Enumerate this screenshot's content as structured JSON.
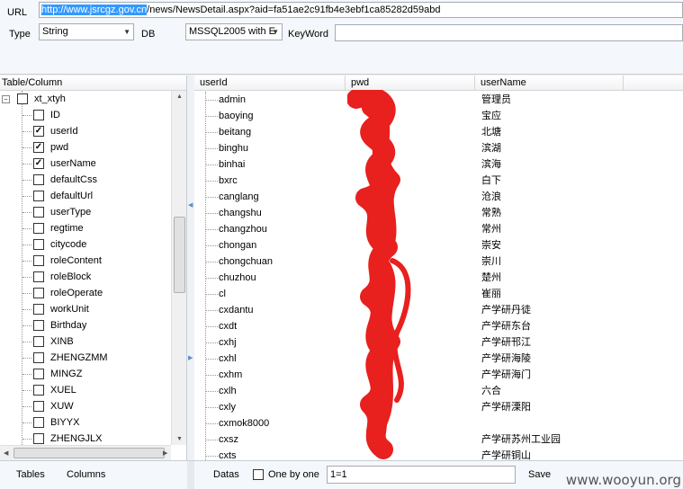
{
  "top": {
    "url_label": "URL",
    "url_selected": "http://www.jsrcgz.gov.cn",
    "url_rest": "/news/NewsDetail.aspx?aid=fa51ae2c91fb4e3ebf1ca85282d59abd",
    "type_label": "Type",
    "type_value": "String",
    "db_label": "DB",
    "db_value": "MSSQL2005 with E",
    "keyword_label": "KeyWord",
    "keyword_value": ""
  },
  "tree": {
    "header": "Table/Column",
    "table": {
      "name": "xt_xtyh",
      "expander": "−"
    },
    "columns": [
      {
        "name": "ID",
        "checked": false
      },
      {
        "name": "userId",
        "checked": true
      },
      {
        "name": "pwd",
        "checked": true
      },
      {
        "name": "userName",
        "checked": true
      },
      {
        "name": "defaultCss",
        "checked": false
      },
      {
        "name": "defaultUrl",
        "checked": false
      },
      {
        "name": "userType",
        "checked": false
      },
      {
        "name": "regtime",
        "checked": false
      },
      {
        "name": "citycode",
        "checked": false
      },
      {
        "name": "roleContent",
        "checked": false
      },
      {
        "name": "roleBlock",
        "checked": false
      },
      {
        "name": "roleOperate",
        "checked": false
      },
      {
        "name": "workUnit",
        "checked": false
      },
      {
        "name": "Birthday",
        "checked": false
      },
      {
        "name": "XINB",
        "checked": false
      },
      {
        "name": "ZHENGZMM",
        "checked": false
      },
      {
        "name": "MINGZ",
        "checked": false
      },
      {
        "name": "XUEL",
        "checked": false
      },
      {
        "name": "XUW",
        "checked": false
      },
      {
        "name": "BIYYX",
        "checked": false
      },
      {
        "name": "ZHENGJLX",
        "checked": false
      }
    ]
  },
  "grid": {
    "headers": [
      "userId",
      "pwd",
      "userName"
    ],
    "rows": [
      {
        "userId": "admin",
        "userName": "管理员"
      },
      {
        "userId": "baoying",
        "userName": "宝应"
      },
      {
        "userId": "beitang",
        "userName": "北塘"
      },
      {
        "userId": "binghu",
        "userName": "滨湖"
      },
      {
        "userId": "binhai",
        "userName": "滨海"
      },
      {
        "userId": "bxrc",
        "userName": "白下"
      },
      {
        "userId": "canglang",
        "userName": "沧浪"
      },
      {
        "userId": "changshu",
        "userName": "常熟"
      },
      {
        "userId": "changzhou",
        "userName": "常州"
      },
      {
        "userId": "chongan",
        "userName": "崇安"
      },
      {
        "userId": "chongchuan",
        "userName": "崇川"
      },
      {
        "userId": "chuzhou",
        "userName": "楚州"
      },
      {
        "userId": "cl",
        "userName": "崔丽"
      },
      {
        "userId": "cxdantu",
        "userName": "产学研丹徒"
      },
      {
        "userId": "cxdt",
        "userName": "产学研东台"
      },
      {
        "userId": "cxhj",
        "userName": "产学研邗江"
      },
      {
        "userId": "cxhl",
        "userName": "产学研海陵"
      },
      {
        "userId": "cxhm",
        "userName": "产学研海门"
      },
      {
        "userId": "cxlh",
        "userName": "六合"
      },
      {
        "userId": "cxly",
        "userName": "产学研溧阳"
      },
      {
        "userId": "cxmok8000",
        "userName": ""
      },
      {
        "userId": "cxsz",
        "userName": "产学研苏州工业园"
      },
      {
        "userId": "cxts",
        "userName": "产学研铜山"
      }
    ]
  },
  "bottom": {
    "tables_label": "Tables",
    "columns_label": "Columns",
    "datas_label": "Datas",
    "one_by_one_label": "One by one",
    "where_value": "1=1",
    "save_label": "Save",
    "watermark": "www.wooyun.org"
  },
  "colors": {
    "selection": "#3399ff",
    "redaction": "#e8201e"
  }
}
